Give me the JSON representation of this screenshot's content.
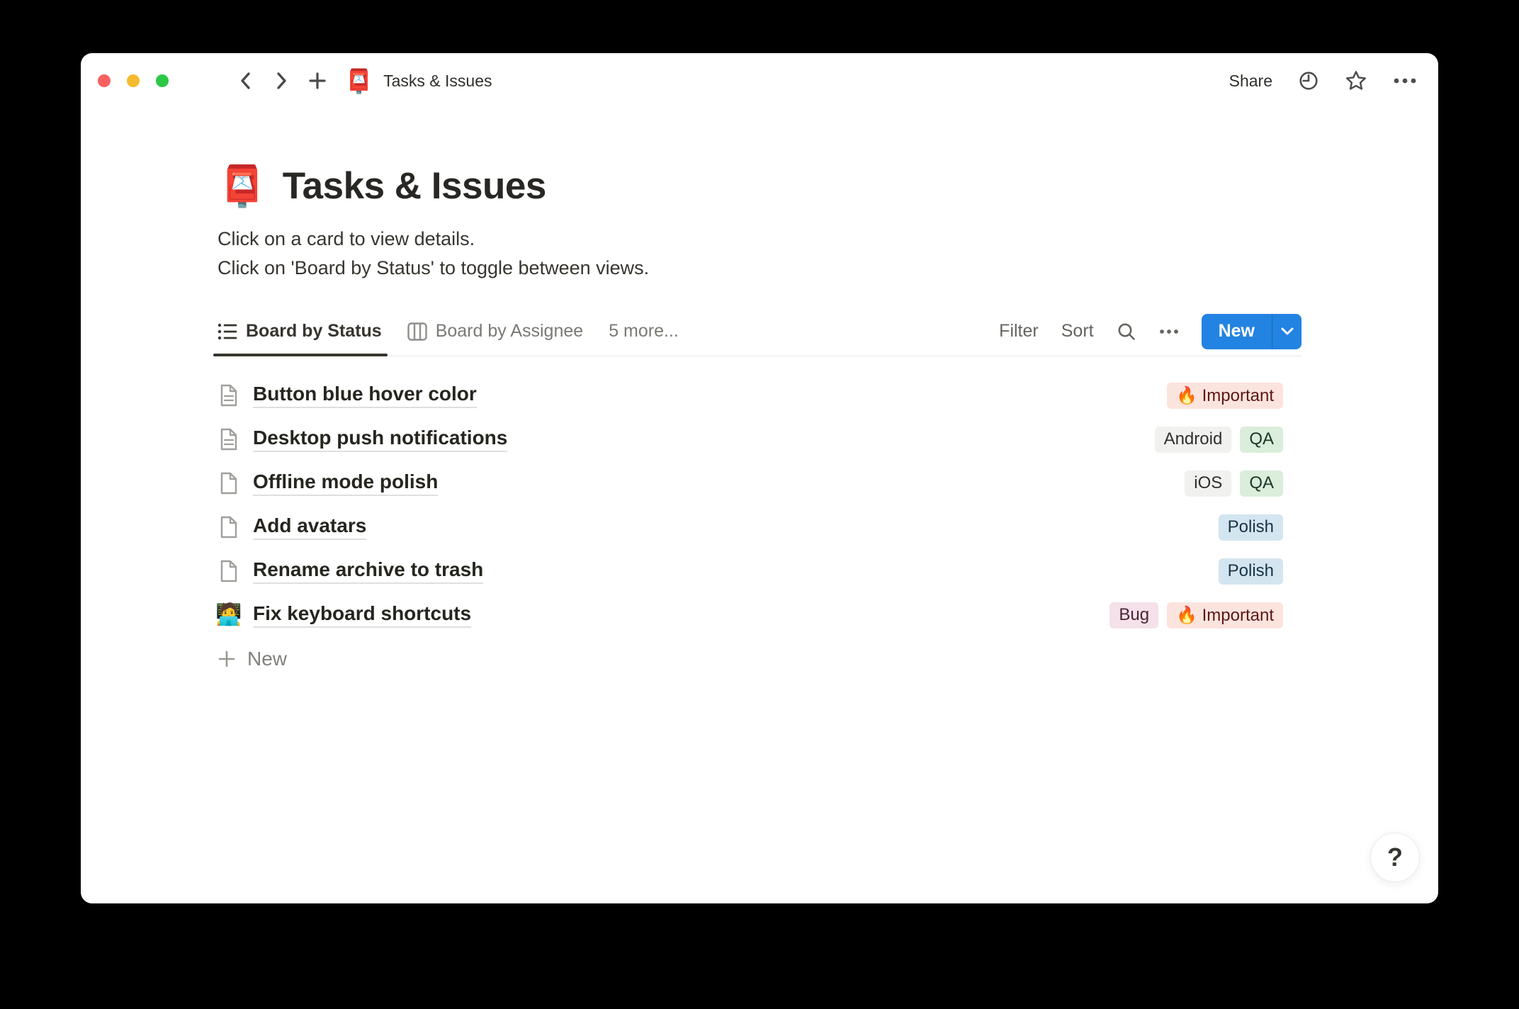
{
  "window": {
    "titlebar": {
      "emoji": "📮",
      "title": "Tasks & Issues",
      "share_label": "Share"
    },
    "page": {
      "emoji": "📮",
      "title": "Tasks & Issues",
      "description_lines": [
        "Click on a card to view details.",
        "Click on 'Board by Status' to toggle between views."
      ]
    },
    "views": {
      "tabs": [
        {
          "label": "Board by Status",
          "icon": "list-view-icon",
          "active": true
        },
        {
          "label": "Board by Assignee",
          "icon": "board-view-icon",
          "active": false
        }
      ],
      "more_label": "5 more...",
      "controls": {
        "filter_label": "Filter",
        "sort_label": "Sort",
        "new_label": "New"
      }
    },
    "list": {
      "rows": [
        {
          "icon": "page-text-icon",
          "title": "Button blue hover color",
          "tags": [
            {
              "label": "🔥 Important",
              "color": "red"
            }
          ]
        },
        {
          "icon": "page-text-icon",
          "title": "Desktop push notifications",
          "tags": [
            {
              "label": "Android",
              "color": "gray"
            },
            {
              "label": "QA",
              "color": "green"
            }
          ]
        },
        {
          "icon": "page-icon",
          "title": "Offline mode polish",
          "tags": [
            {
              "label": "iOS",
              "color": "gray"
            },
            {
              "label": "QA",
              "color": "green"
            }
          ]
        },
        {
          "icon": "page-icon",
          "title": "Add avatars",
          "tags": [
            {
              "label": "Polish",
              "color": "blue"
            }
          ]
        },
        {
          "icon": "page-icon",
          "title": "Rename archive to trash",
          "tags": [
            {
              "label": "Polish",
              "color": "blue"
            }
          ]
        },
        {
          "icon": "technologist-emoji",
          "emoji": "🧑‍💻",
          "title": "Fix keyboard shortcuts",
          "tags": [
            {
              "label": "Bug",
              "color": "pink"
            },
            {
              "label": "🔥 Important",
              "color": "red"
            }
          ]
        }
      ],
      "new_row_label": "New"
    },
    "help_label": "?",
    "colors": {
      "accent_blue": "#2383E2",
      "tag_red_bg": "#FCE4DE",
      "tag_red_text": "#5D1715",
      "tag_gray_bg": "#F1F1EF",
      "tag_gray_text": "#32302C",
      "tag_green_bg": "#DBEDDB",
      "tag_green_text": "#1C3829",
      "tag_blue_bg": "#D3E5EF",
      "tag_blue_text": "#183347",
      "tag_pink_bg": "#F4E1E9",
      "tag_pink_text": "#4C2337"
    }
  }
}
